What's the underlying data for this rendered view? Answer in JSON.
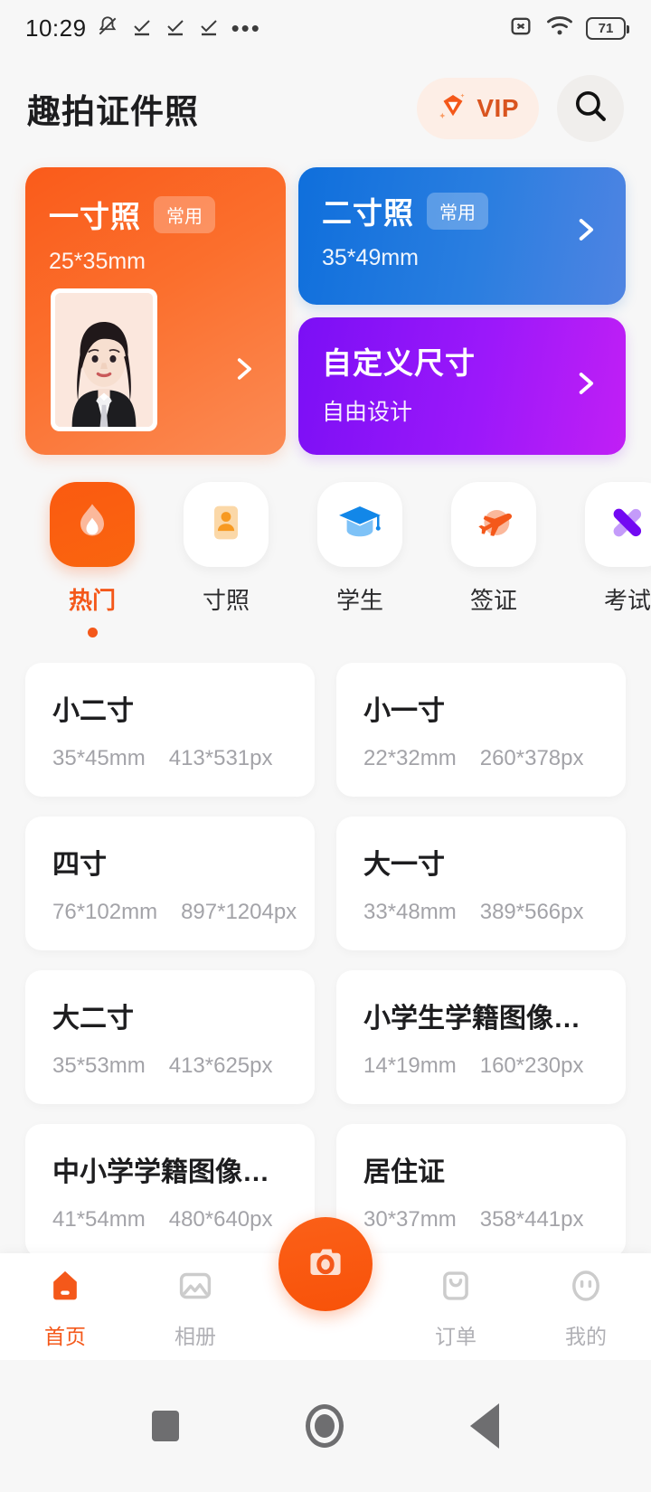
{
  "status_bar": {
    "time": "10:29",
    "battery_level": "71",
    "left_icons": [
      "mute-bell-icon",
      "check-icon",
      "check-icon",
      "check-icon",
      "more-dots-icon"
    ],
    "right_icons": [
      "sim-error-icon",
      "wifi-icon",
      "battery-icon"
    ]
  },
  "header": {
    "title": "趣拍证件照",
    "vip_label": "VIP",
    "vip_icon": "vip-diamond-icon",
    "search_icon": "search-icon"
  },
  "hero": {
    "primary": {
      "title": "一寸照",
      "badge": "常用",
      "size": "25*35mm",
      "arrow": "chevron-right-icon"
    },
    "secondary": {
      "title": "二寸照",
      "badge": "常用",
      "size": "35*49mm",
      "arrow": "chevron-right-icon"
    },
    "custom": {
      "title": "自定义尺寸",
      "subtitle": "自由设计",
      "arrow": "chevron-right-icon"
    }
  },
  "categories": {
    "active_index": 0,
    "items": [
      {
        "label": "热门",
        "icon": "flame-icon"
      },
      {
        "label": "寸照",
        "icon": "id-card-icon"
      },
      {
        "label": "学生",
        "icon": "graduation-cap-icon"
      },
      {
        "label": "签证",
        "icon": "airplane-icon"
      },
      {
        "label": "考试",
        "icon": "pencil-cross-icon"
      }
    ]
  },
  "sizes": [
    {
      "name": "小二寸",
      "mm": "35*45mm",
      "px": "413*531px"
    },
    {
      "name": "小一寸",
      "mm": "22*32mm",
      "px": "260*378px"
    },
    {
      "name": "四寸",
      "mm": "76*102mm",
      "px": "897*1204px"
    },
    {
      "name": "大一寸",
      "mm": "33*48mm",
      "px": "389*566px"
    },
    {
      "name": "大二寸",
      "mm": "35*53mm",
      "px": "413*625px"
    },
    {
      "name": "小学生学籍图像信息...",
      "mm": "14*19mm",
      "px": "160*230px"
    },
    {
      "name": "中小学学籍图像采集",
      "mm": "41*54mm",
      "px": "480*640px"
    },
    {
      "name": "居住证",
      "mm": "30*37mm",
      "px": "358*441px"
    }
  ],
  "tabbar": {
    "active_index": 0,
    "items": [
      {
        "label": "首页",
        "icon": "home-icon"
      },
      {
        "label": "相册",
        "icon": "album-icon"
      },
      {
        "label": "订单",
        "icon": "order-bag-icon"
      },
      {
        "label": "我的",
        "icon": "person-icon"
      }
    ],
    "camera_button_icon": "camera-icon"
  },
  "system_nav": {
    "recents_icon": "square-icon",
    "home_icon": "circle-icon",
    "back_icon": "triangle-back-icon"
  },
  "colors": {
    "accent": "#f4581a",
    "blue": "#1a73dd",
    "purple": "#9b18fa",
    "page_bg": "#f7f7f7"
  }
}
